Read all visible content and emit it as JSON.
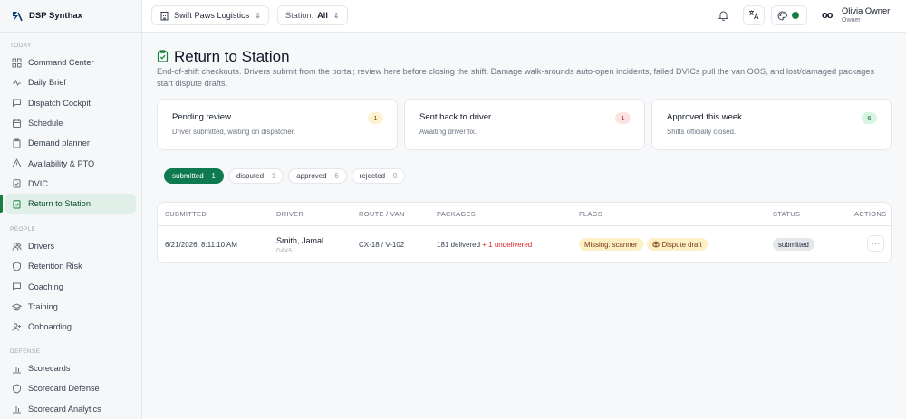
{
  "brand": {
    "name": "DSP Synthax"
  },
  "sidebar": {
    "sections": [
      {
        "label": "TODAY",
        "items": [
          {
            "label": "Command Center",
            "icon": "grid-icon"
          },
          {
            "label": "Daily Brief",
            "icon": "pulse-icon"
          },
          {
            "label": "Dispatch Cockpit",
            "icon": "chat-icon"
          },
          {
            "label": "Schedule",
            "icon": "calendar-icon"
          },
          {
            "label": "Demand planner",
            "icon": "clipboard-icon"
          },
          {
            "label": "Availability & PTO",
            "icon": "warning-icon"
          },
          {
            "label": "DVIC",
            "icon": "clipboard-check-icon"
          },
          {
            "label": "Return to Station",
            "icon": "clipboard-return-icon",
            "active": true
          }
        ]
      },
      {
        "label": "PEOPLE",
        "items": [
          {
            "label": "Drivers",
            "icon": "users-icon"
          },
          {
            "label": "Retention Risk",
            "icon": "shield-icon"
          },
          {
            "label": "Coaching",
            "icon": "message-icon"
          },
          {
            "label": "Training",
            "icon": "mortarboard-icon"
          },
          {
            "label": "Onboarding",
            "icon": "user-plus-icon"
          }
        ]
      },
      {
        "label": "DEFENSE",
        "items": [
          {
            "label": "Scorecards",
            "icon": "bar-chart-icon"
          },
          {
            "label": "Scorecard Defense",
            "icon": "shield-icon"
          },
          {
            "label": "Scorecard Analytics",
            "icon": "bar-chart-icon"
          }
        ]
      }
    ]
  },
  "topbar": {
    "org": "Swift Paws Logistics",
    "station_label": "Station:",
    "station_value": "All",
    "user_name": "Olivia Owner",
    "user_role": "Owner",
    "status_color": "#15803d"
  },
  "page": {
    "title": "Return to Station",
    "description": "End-of-shift checkouts. Drivers submit from the portal; review here before closing the shift. Damage walk-arounds auto-open incidents, failed DVICs pull the van OOS, and lost/damaged packages start dispute drafts."
  },
  "cards": [
    {
      "title": "Pending review",
      "sub": "Driver submitted, waiting on dispatcher.",
      "count": "1",
      "bg": "#fdf3d1",
      "fg": "#92400e"
    },
    {
      "title": "Sent back to driver",
      "sub": "Awaiting driver fix.",
      "count": "1",
      "bg": "#fde2e2",
      "fg": "#991b1b"
    },
    {
      "title": "Approved this week",
      "sub": "Shifts officially closed.",
      "count": "6",
      "bg": "#d7f5e3",
      "fg": "#166534"
    }
  ],
  "filters": [
    {
      "label": "submitted",
      "count": "1",
      "active": true
    },
    {
      "label": "disputed",
      "count": "1"
    },
    {
      "label": "approved",
      "count": "6"
    },
    {
      "label": "rejected",
      "count": "0"
    }
  ],
  "table": {
    "headers": [
      "SUBMITTED",
      "DRIVER",
      "ROUTE / VAN",
      "PACKAGES",
      "FLAGS",
      "STATUS",
      "ACTIONS"
    ],
    "rows": [
      {
        "submitted": "6/21/2026, 8:11:10 AM",
        "driver": "Smith, Jamal",
        "driver_code": "DAX5",
        "route_van": "CX-18 / V-102",
        "packages_delivered": "181 delivered",
        "packages_undelivered": "+ 1 undelivered",
        "flag_missing": "Missing: scanner",
        "flag_dispute": "Dispute draft",
        "status": "submitted"
      }
    ]
  }
}
